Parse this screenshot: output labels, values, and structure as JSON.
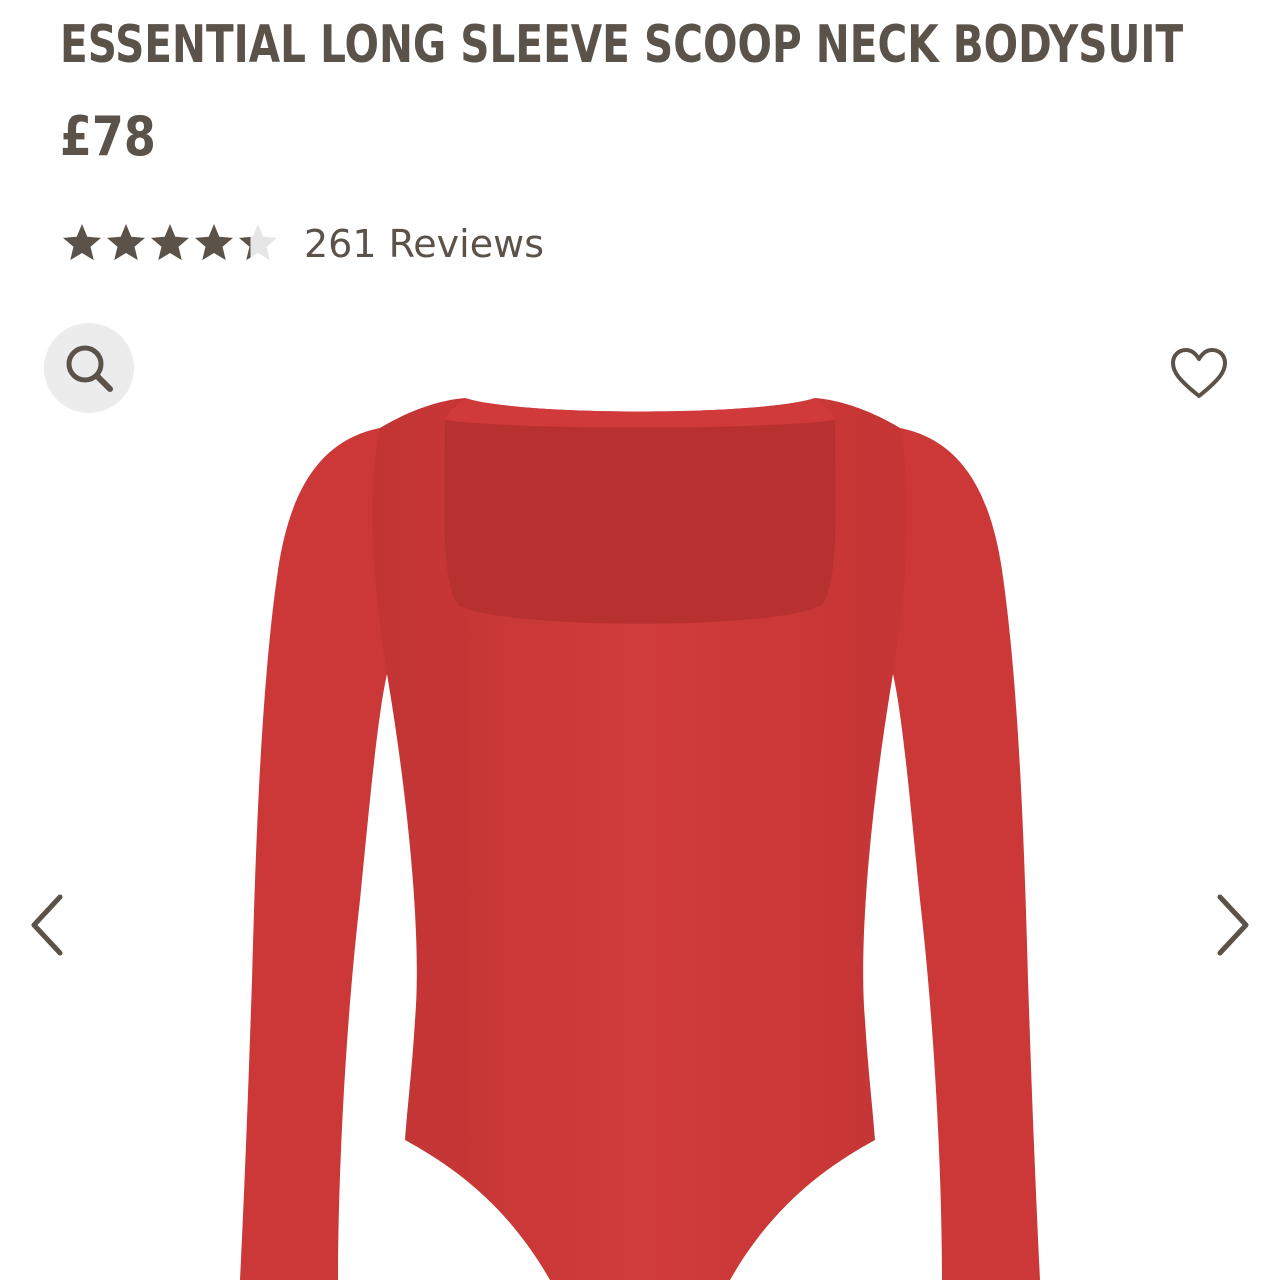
{
  "product": {
    "title": "ESSENTIAL LONG SLEEVE SCOOP NECK BODYSUIT",
    "price": "£78",
    "rating": {
      "value": 4.3,
      "max": 5,
      "reviews_label": "261 Reviews"
    },
    "color_hex": "#d13a3a"
  },
  "icons": {
    "zoom": "search-icon",
    "wishlist": "heart-outline-icon",
    "prev": "chevron-left-icon",
    "next": "chevron-right-icon"
  },
  "colors": {
    "text": "#5b5249",
    "star_filled": "#5b5249",
    "star_empty": "#e6e6e6",
    "zoom_bg": "#ececec"
  }
}
